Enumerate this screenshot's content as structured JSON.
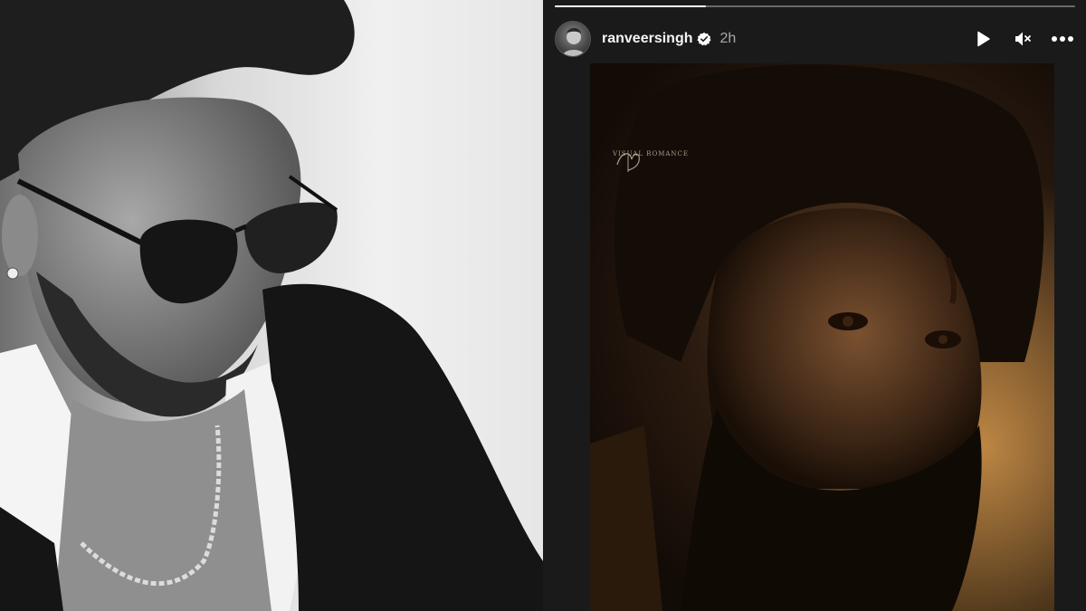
{
  "story": {
    "username": "ranveersingh",
    "timestamp": "2h",
    "progress": 0.29,
    "verified": true,
    "controls": {
      "play_icon": "play-icon",
      "mute_icon": "volume-muted-icon",
      "more_icon": "more-options-icon"
    },
    "media": {
      "watermark": "VISUAL ROMANCE"
    }
  },
  "colors": {
    "viewer_background": "#1a1a1a",
    "verified_badge": "#ffffff",
    "timestamp": "#a8a8a8"
  }
}
